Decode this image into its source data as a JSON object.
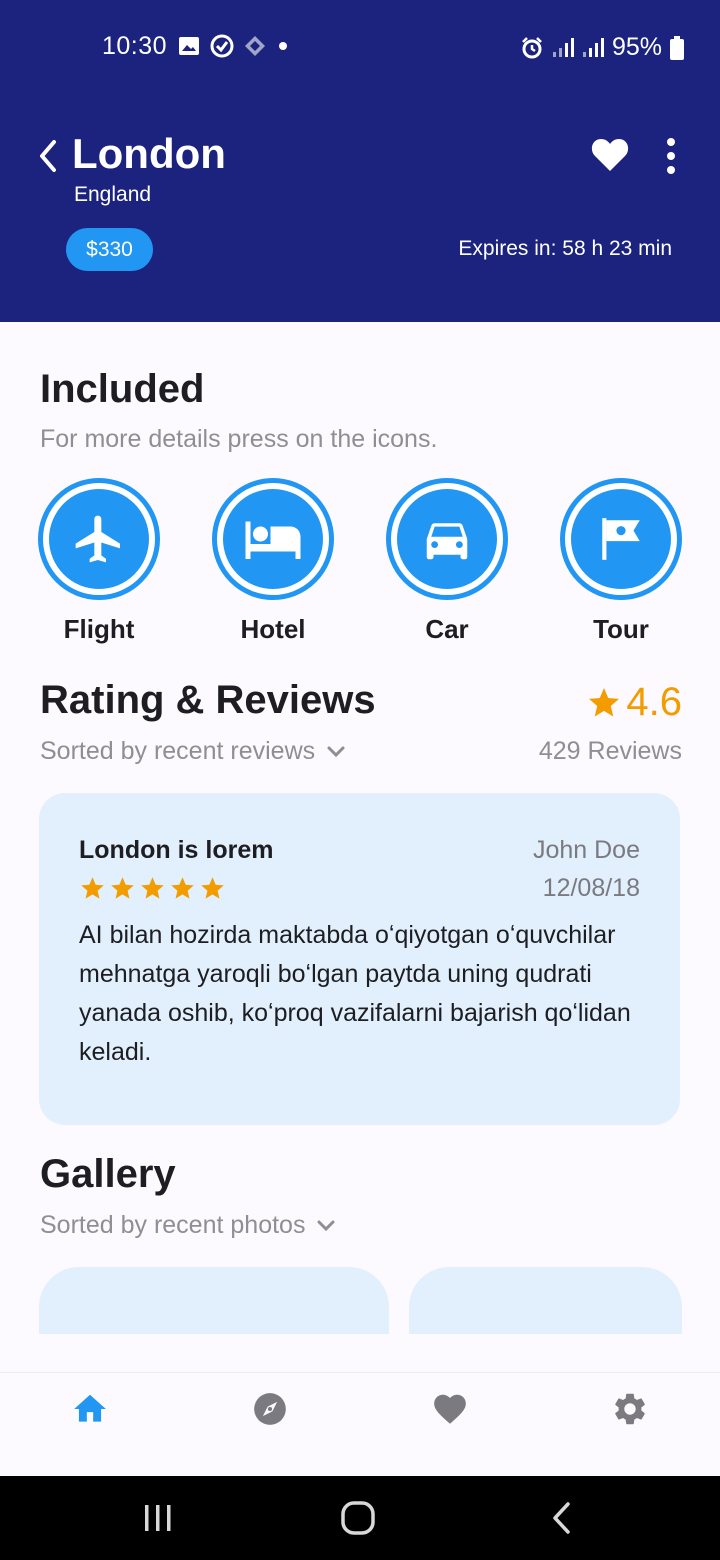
{
  "status_bar": {
    "time": "10:30",
    "battery": "95%",
    "left_icons": [
      "image-icon",
      "messenger-icon",
      "diamond-icon",
      "dot-icon"
    ],
    "right_icons": [
      "alarm-icon",
      "signal-icon",
      "signal-icon",
      "battery-icon"
    ]
  },
  "header": {
    "city": "London",
    "country": "England",
    "price": "$330",
    "expires": "Expires in: 58 h 23 min",
    "bg_color": "#1b237e",
    "accent_color": "#2196f3"
  },
  "included": {
    "title": "Included",
    "subtitle": "For more details press on the icons.",
    "items": [
      {
        "label": "Flight",
        "icon": "airplane-icon"
      },
      {
        "label": "Hotel",
        "icon": "bed-icon"
      },
      {
        "label": "Car",
        "icon": "car-icon"
      },
      {
        "label": "Tour",
        "icon": "flag-icon"
      }
    ]
  },
  "reviews": {
    "title": "Rating & Reviews",
    "sort_label": "Sorted by recent reviews",
    "rating": "4.6",
    "count": "429 Reviews",
    "rating_color": "#f39c00",
    "card": {
      "title": "London is lorem",
      "author": "John Doe",
      "date": "12/08/18",
      "stars": 5,
      "body": "AI bilan hozirda maktabda oʻqiyotgan oʻquvchilar mehnatga yaroqli boʻlgan paytda uning qudrati yanada oshib, koʻproq vazifalarni bajarish qoʻlidan keladi."
    }
  },
  "gallery": {
    "title": "Gallery",
    "sort_label": "Sorted by recent photos"
  },
  "bottom_nav": {
    "items": [
      "home-icon",
      "compass-icon",
      "heart-icon",
      "settings-icon"
    ],
    "active": "home-icon"
  }
}
